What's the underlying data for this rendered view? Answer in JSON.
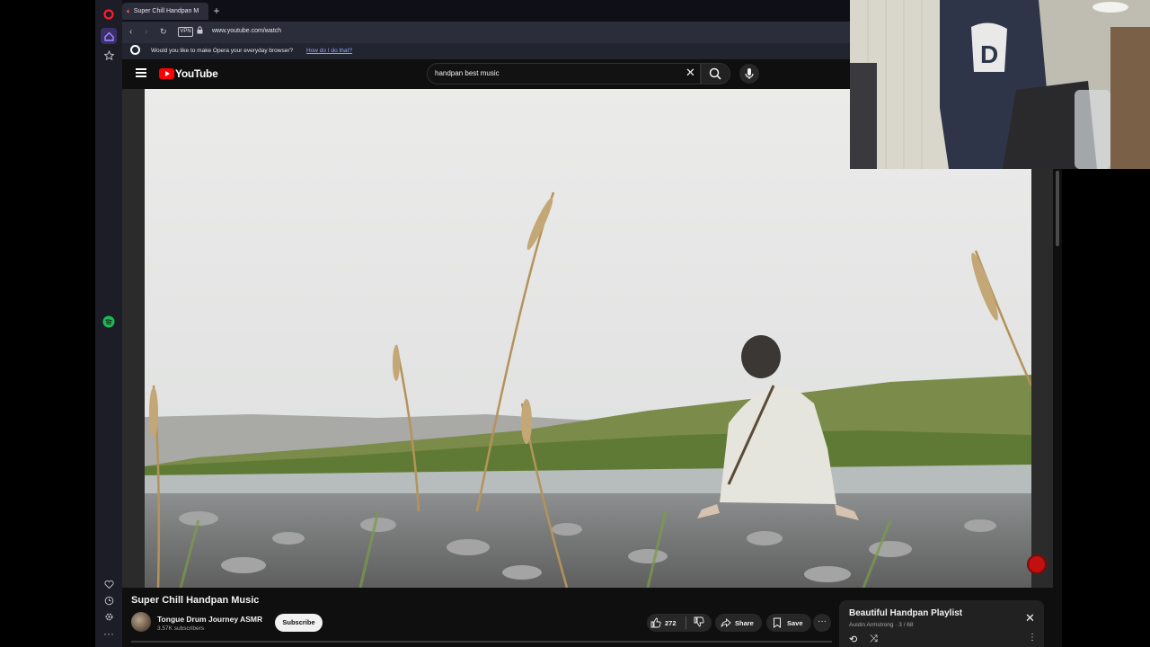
{
  "browser": {
    "tab_title": "Super Chill Handpan M",
    "new_tab_label": "+",
    "vpn_label": "VPN",
    "url": "www.youtube.com/watch",
    "infobar_message": "Would you like to make Opera your everyday browser?",
    "infobar_link": "How do I do that?"
  },
  "youtube": {
    "logo_text": "YouTube",
    "search_query": "handpan best music",
    "video_title": "Super Chill Handpan Music",
    "channel_name": "Tongue Drum Journey ASMR",
    "subscriber_count": "3.57K subscribers",
    "subscribe_label": "Subscribe",
    "like_count": "272",
    "share_label": "Share",
    "save_label": "Save"
  },
  "playlist": {
    "title": "Beautiful Handpan Playlist",
    "meta": "Austin Armstrong · 3 / 68"
  },
  "colors": {
    "youtube_red": "#ff0000",
    "opera_red": "#ff1b2d",
    "opera_active": "#7b4cff",
    "spotify_green": "#1db954"
  }
}
